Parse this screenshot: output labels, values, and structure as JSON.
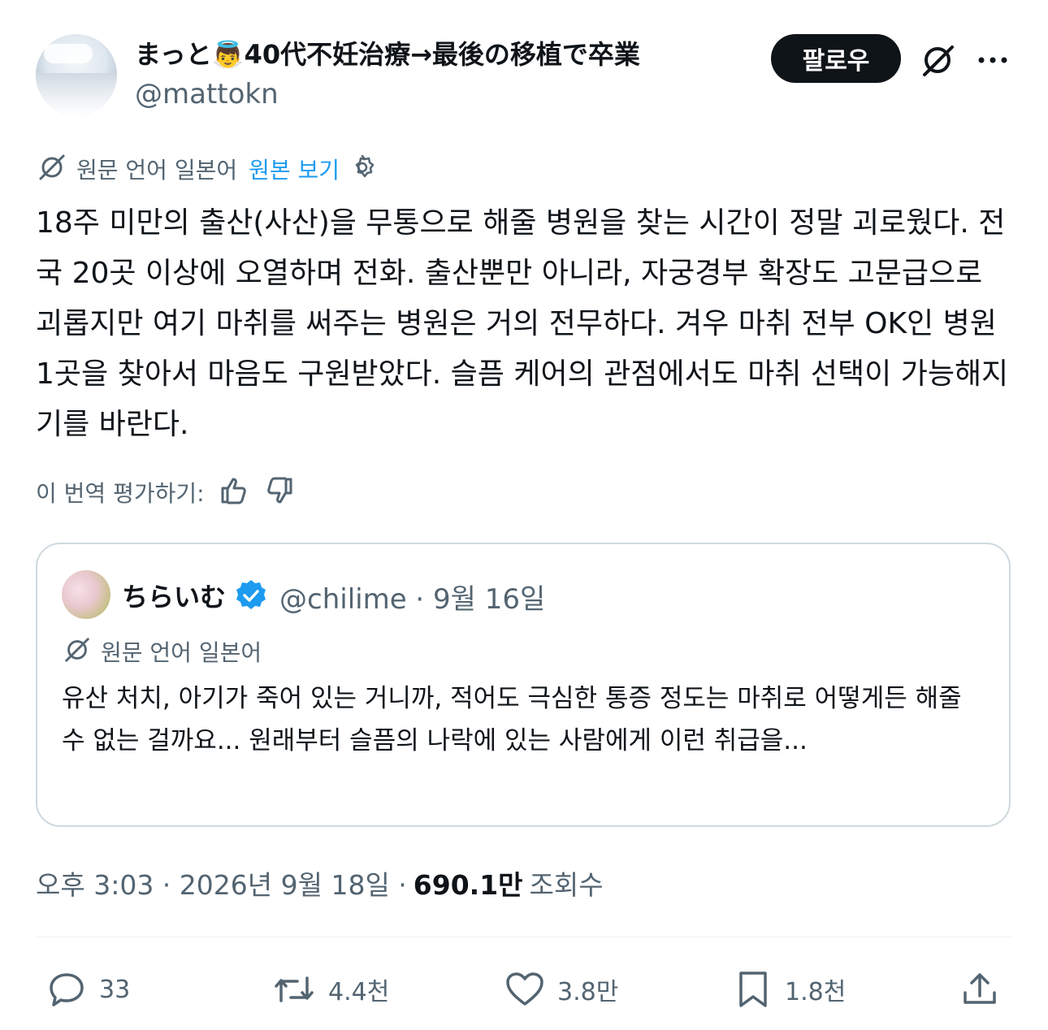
{
  "author": {
    "display_name": "まっと👼40代不妊治療→最後の移植で卒業",
    "handle": "@mattokn",
    "follow_label": "팔로우"
  },
  "translation": {
    "source_label": "원문 언어 일본어",
    "view_original": "원본 보기"
  },
  "tweet_text": "18주 미만의 출산(사산)을 무통으로 해줄 병원을 찾는 시간이 정말 괴로웠다. 전국 20곳 이상에 오열하며 전화. 출산뿐만 아니라, 자궁경부 확장도 고문급으로 괴롭지만 여기 마취를 써주는 병원은 거의 전무하다. 겨우 마취 전부 OK인 병원 1곳을 찾아서 마음도 구원받았다. 슬픔 케어의 관점에서도 마취 선택이 가능해지기를 바란다.",
  "rate": {
    "label": "이 번역 평가하기:"
  },
  "quote": {
    "display_name": "ちらいむ",
    "meta": "@chilime · 9월 16일",
    "source_label": "원문 언어 일본어",
    "text": "유산 처치, 아기가 죽어 있는 거니까, 적어도 극심한 통증 정도는 마취로 어떻게든 해줄 수 없는 걸까요... 원래부터 슬픔의 나락에 있는 사람에게 이런 취급을..."
  },
  "timestamp": {
    "time": "오후 3:03 · 2026년 9월 18일 ·",
    "views": "690.1만",
    "views_label": "조회수"
  },
  "actions": {
    "replies": "33",
    "reposts": "4.4천",
    "likes": "3.8만",
    "bookmarks": "1.8천"
  },
  "colors": {
    "accent": "#1d9bf0",
    "text": "#0f1419",
    "muted": "#536471",
    "border": "#cfd9de"
  },
  "icons": [
    "grok-icon",
    "more-icon",
    "settings-icon",
    "thumbs-up-icon",
    "thumbs-down-icon",
    "verified-icon",
    "reply-icon",
    "repost-icon",
    "like-icon",
    "bookmark-icon",
    "share-icon"
  ]
}
